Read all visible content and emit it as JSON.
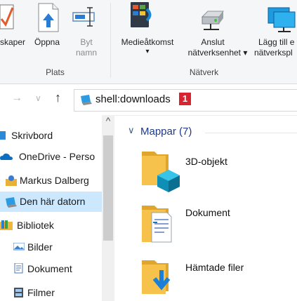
{
  "ribbon": {
    "plats_group": "Plats",
    "natverk_group": "Nätverk",
    "buttons": {
      "skaper": "skaper",
      "oppna": "Öppna",
      "byt_line1": "Byt",
      "byt_line2": "namn",
      "medieatkomst": "Medieåtkomst",
      "medieatkomst_arrow": "▾",
      "anslut_line1": "Anslut",
      "anslut_line2": "nätverksenhet ▾",
      "lagg_line1": "Lägg till e",
      "lagg_line2": "nätverkspl"
    }
  },
  "address_bar": {
    "back": "→",
    "dropdown": "∨",
    "up": "↑",
    "path": "shell:downloads",
    "badge": "1"
  },
  "nav_pane": {
    "scroll_up": "^",
    "items": [
      {
        "label": "Skrivbord"
      },
      {
        "label": "OneDrive - Perso"
      },
      {
        "label": "Markus Dalberg"
      },
      {
        "label": "Den här datorn"
      },
      {
        "label": "Bibliotek"
      },
      {
        "label": "Bilder"
      },
      {
        "label": "Dokument"
      },
      {
        "label": "Filmer"
      }
    ]
  },
  "content": {
    "group_toggle": "∨",
    "group_header": "Mappar (7)",
    "folders": [
      {
        "label": "3D-objekt",
        "icon": "3d-objects-folder-icon"
      },
      {
        "label": "Dokument",
        "icon": "documents-folder-icon"
      },
      {
        "label": "Hämtade filer",
        "icon": "downloads-folder-icon"
      }
    ]
  },
  "colors": {
    "selection": "#cce8ff",
    "badge": "#d9232e",
    "folder": "#f7c24c",
    "accent": "#0078d7"
  }
}
